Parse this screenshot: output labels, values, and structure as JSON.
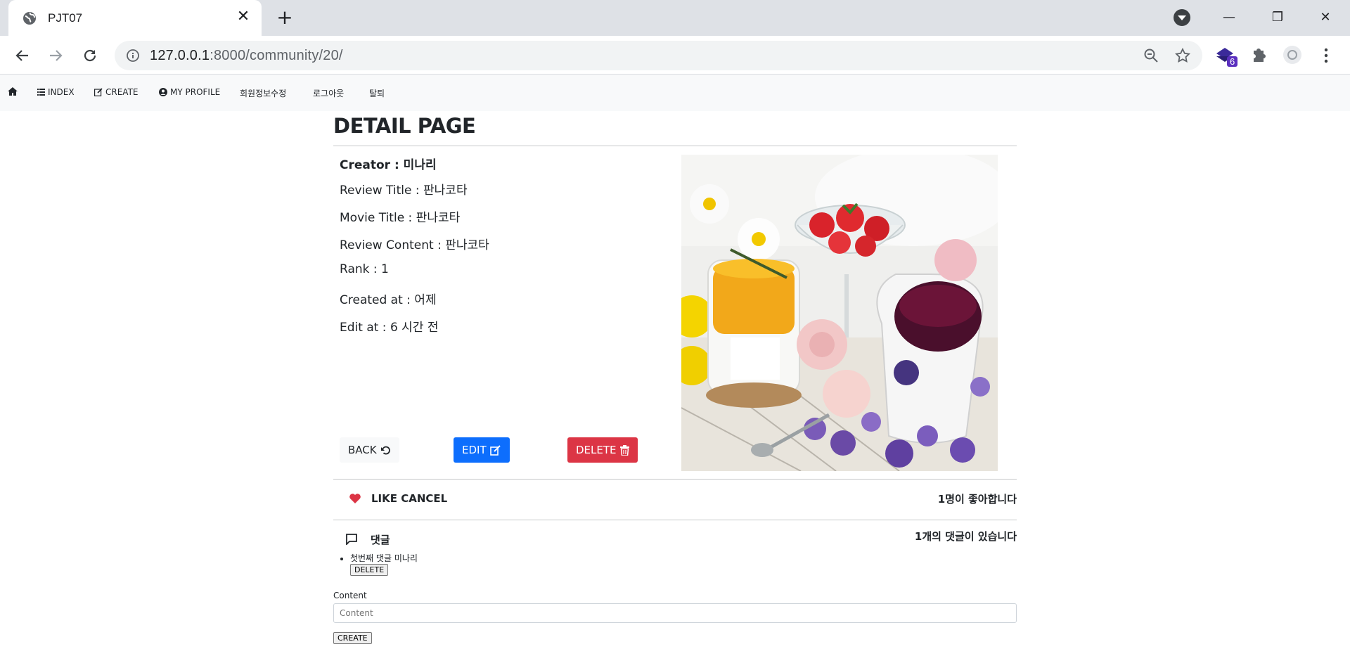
{
  "browser": {
    "tab_title": "PJT07",
    "url_host": "127.0.0.1",
    "url_rest": ":8000/community/20/",
    "extension_badge": "6"
  },
  "nav": {
    "items": [
      {
        "label": "INDEX"
      },
      {
        "label": "CREATE"
      },
      {
        "label": "MY PROFILE"
      },
      {
        "label": "회원정보수정"
      },
      {
        "label": "로그아웃"
      },
      {
        "label": "탈퇴"
      }
    ]
  },
  "page": {
    "title": "DETAIL PAGE",
    "creator": "Creator : 미나리",
    "review_title": "Review Title : 판나코타",
    "movie_title": "Movie Title : 판나코타",
    "review_content": "Review Content : 판나코타",
    "rank": "Rank : 1",
    "created_at": "Created at : 어제",
    "edit_at": "Edit at : 6 시간 전",
    "buttons": {
      "back": "BACK",
      "edit": "EDIT",
      "delete": "DELETE"
    }
  },
  "like": {
    "label": "LIKE CANCEL",
    "count_text": "1명이 좋아합니다",
    "heart_color": "#dc3545"
  },
  "comments": {
    "label": "댓글",
    "count_text": "1개의 댓글이 있습니다",
    "items": [
      {
        "text": "첫번째 댓글 미나리",
        "delete_label": "DELETE"
      }
    ],
    "form": {
      "label": "Content",
      "placeholder": "Content",
      "submit": "CREATE"
    }
  },
  "colors": {
    "primary": "#0d6efd",
    "danger": "#dc3545",
    "light": "#f8f9fa"
  }
}
